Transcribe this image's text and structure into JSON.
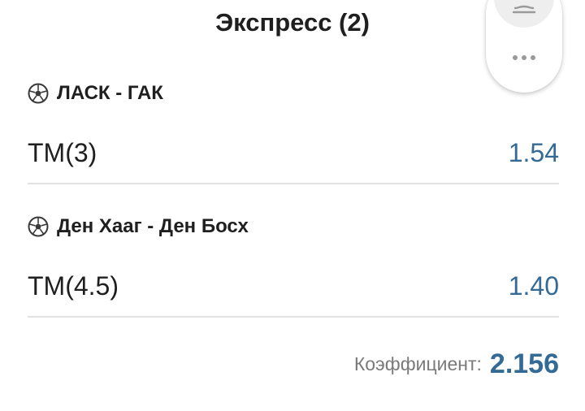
{
  "header": {
    "title": "Экспресс (2)"
  },
  "toolbar": {
    "top_button_icon": "bell-off-icon",
    "more_icon": "more-horizontal-icon"
  },
  "bets": [
    {
      "sport_icon": "soccer-ball-icon",
      "event": "ЛАСК - ГАК",
      "market": "ТМ(3)",
      "odds": "1.54"
    },
    {
      "sport_icon": "soccer-ball-icon",
      "event": "Ден Хааг - Ден Босх",
      "market": "ТМ(4.5)",
      "odds": "1.40"
    }
  ],
  "summary": {
    "label": "Коэффициент:",
    "value": "2.156"
  },
  "colors": {
    "accent": "#336b96",
    "text": "#1f1f1f",
    "muted": "#7a7a7a",
    "divider": "#e2e2e2"
  }
}
